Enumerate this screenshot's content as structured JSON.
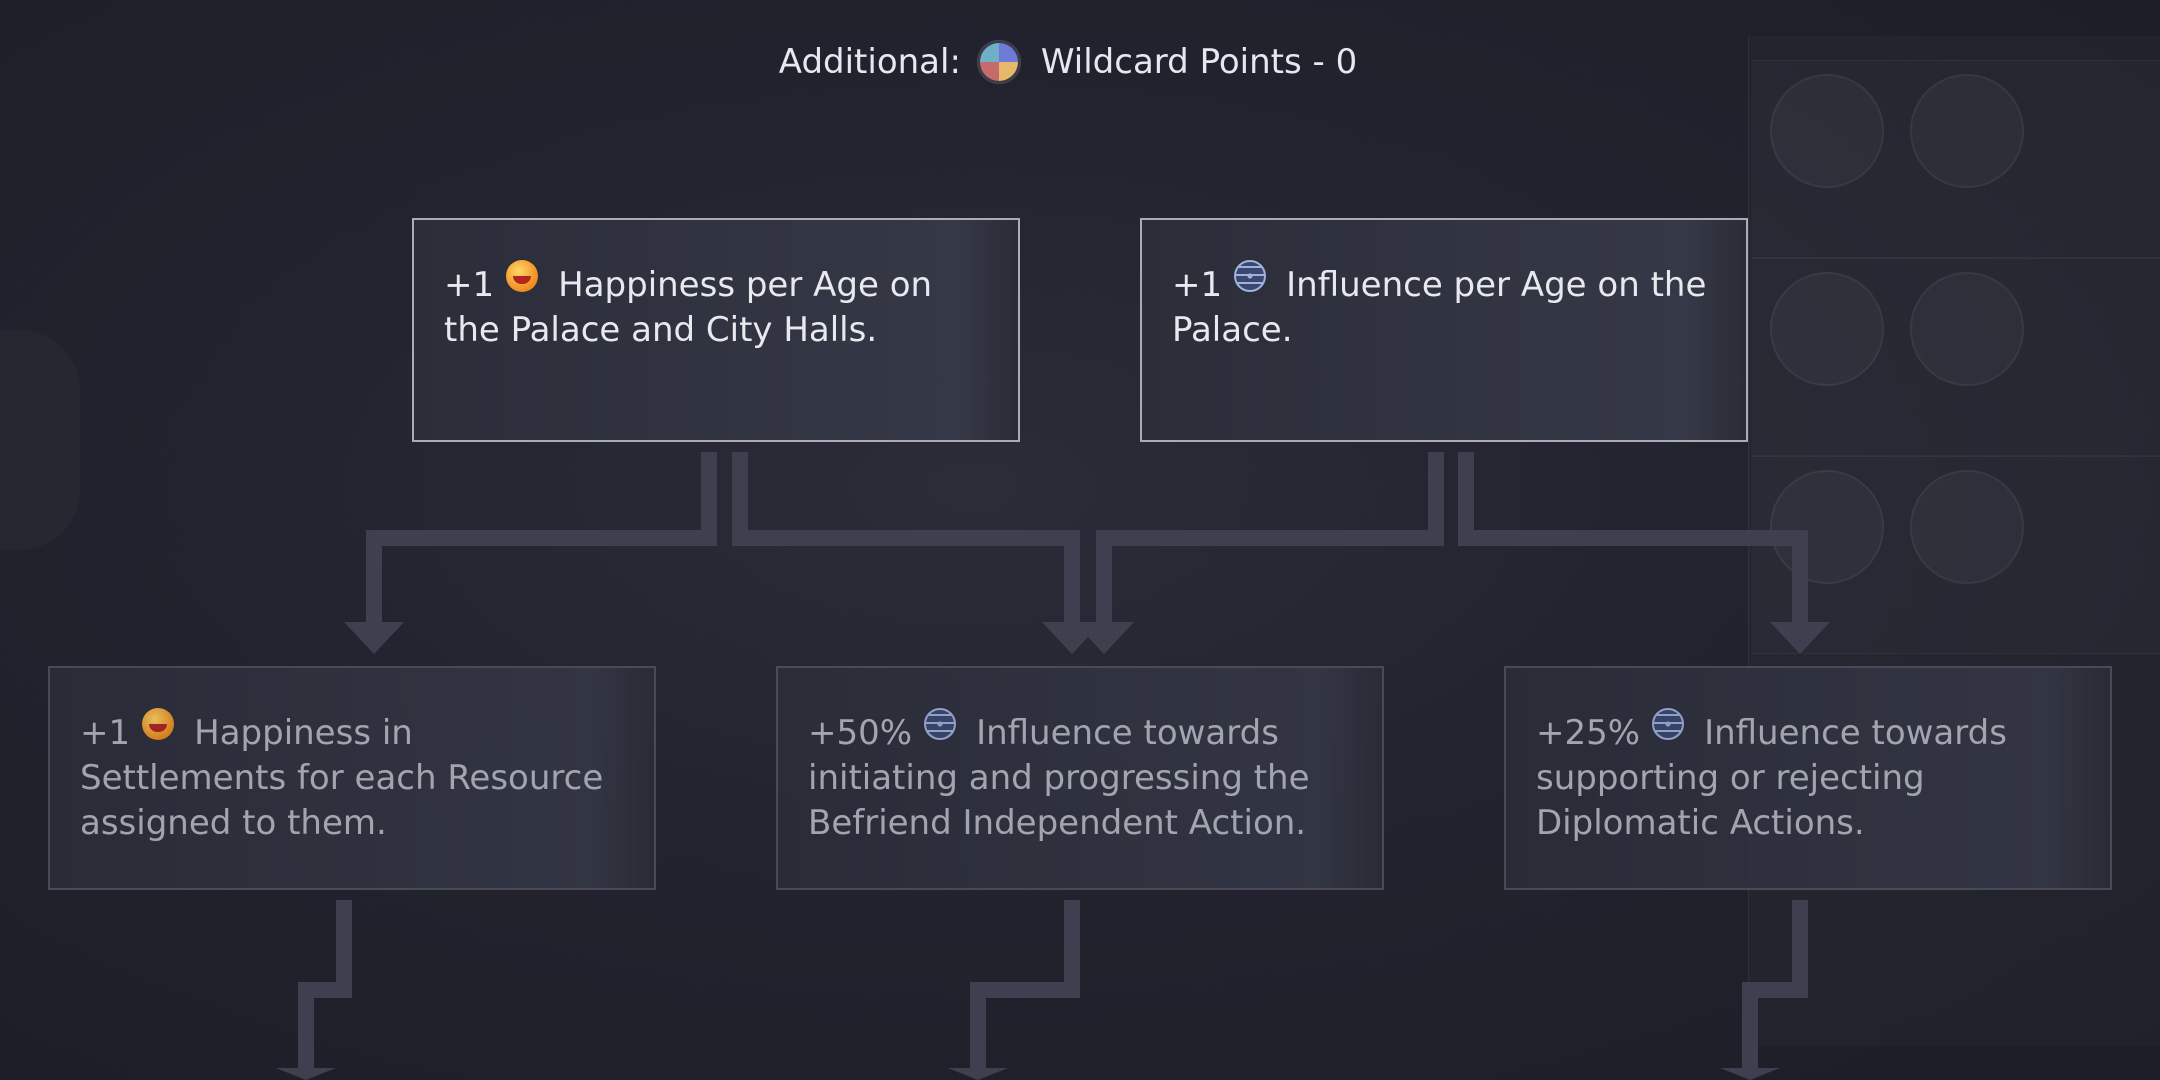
{
  "header": {
    "label": "Additional:",
    "wildcard_icon": "wildcard-points-icon",
    "points_text": "Wildcard Points - 0"
  },
  "colors": {
    "connector": "#3f404f",
    "card_border_active": "#a9abb6",
    "card_border_inactive": "#4e505d"
  },
  "nodes": [
    {
      "prefix": "+1",
      "icon": "happiness-icon",
      "text": "Happiness per Age on the Palace and City Halls.",
      "state": "active"
    },
    {
      "prefix": "+1",
      "icon": "influence-icon",
      "text": "Influence per Age on the Palace.",
      "state": "active"
    },
    {
      "prefix": "+1",
      "icon": "happiness-icon",
      "text": "Happiness in Settlements for each Resource assigned to them.",
      "state": "locked"
    },
    {
      "prefix": "+50%",
      "icon": "influence-icon",
      "text": "Influence towards initiating and progressing the Befriend Independent Action.",
      "state": "locked"
    },
    {
      "prefix": "+25%",
      "icon": "influence-icon",
      "text": "Influence towards supporting or rejecting Diplomatic Actions.",
      "state": "locked"
    }
  ]
}
